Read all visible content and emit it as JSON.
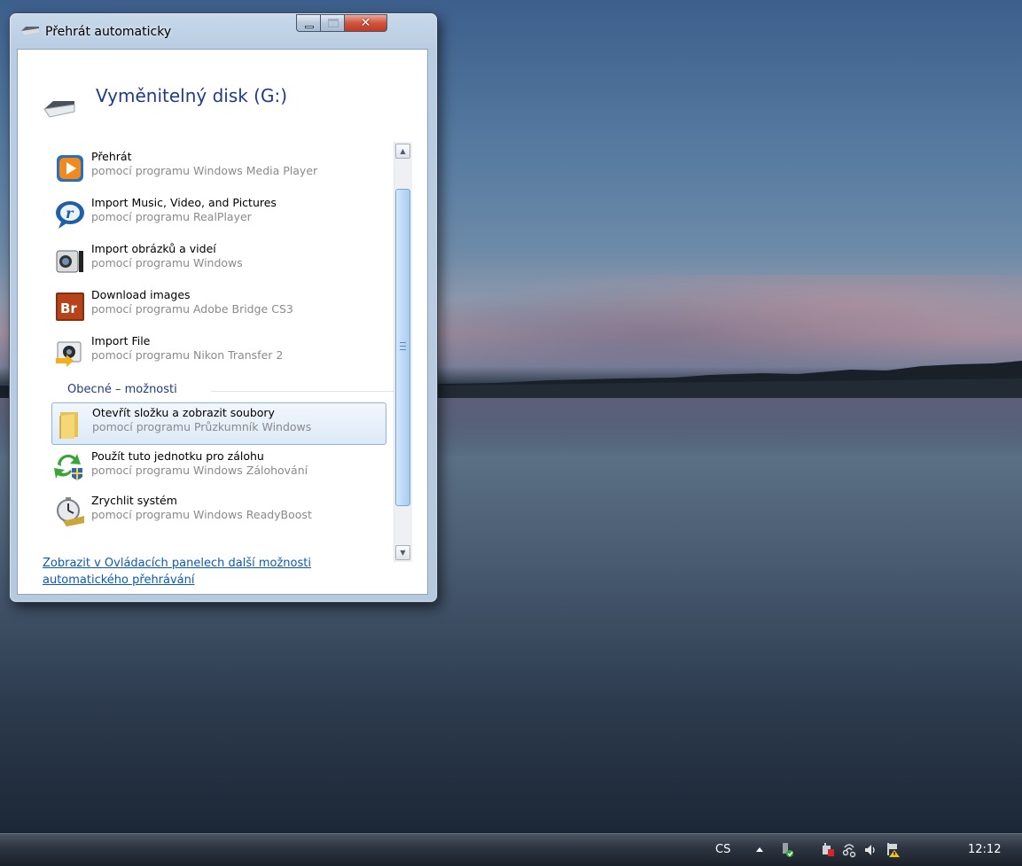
{
  "window": {
    "title": "Přehrát automaticky",
    "device_title": "Vyměnitelný disk (G:)"
  },
  "programs": [
    {
      "action": "Přehrát",
      "source": "pomocí programu Windows Media Player",
      "icon": "windows-media-player-icon"
    },
    {
      "action": "Import Music, Video, and Pictures",
      "source": "pomocí programu RealPlayer",
      "icon": "realplayer-icon"
    },
    {
      "action": "Import obrázků a videí",
      "source": "pomocí programu Windows",
      "icon": "camera-icon"
    },
    {
      "action": "Download images",
      "source": "pomocí programu Adobe Bridge CS3",
      "icon": "adobe-bridge-icon"
    },
    {
      "action": "Import File",
      "source": "pomocí programu Nikon Transfer 2",
      "icon": "nikon-transfer-icon"
    }
  ],
  "general": {
    "header": "Obecné – možnosti",
    "items": [
      {
        "action": "Otevřít složku a zobrazit soubory",
        "source": "pomocí programu Průzkumník Windows",
        "icon": "folder-icon",
        "selected": true
      },
      {
        "action": "Použít tuto jednotku pro zálohu",
        "source": "pomocí programu Windows Zálohování",
        "icon": "backup-icon"
      },
      {
        "action": "Zrychlit systém",
        "source": "pomocí programu Windows ReadyBoost",
        "icon": "readyboost-stopwatch-icon"
      }
    ]
  },
  "footer_link": "Zobrazit v Ovládacích panelech další možnosti automatického přehrávání",
  "taskbar": {
    "language": "CS",
    "clock": "12:12",
    "tray_icons": [
      "show-hidden-icons-arrow",
      "safely-remove-hardware-icon",
      "power-plug-icon",
      "network-icon",
      "volume-icon",
      "action-center-warning-icon"
    ]
  },
  "colors": {
    "heading_blue": "#1e3c8a",
    "link_blue": "#0a59b8",
    "selection_border": "#8eb4e3",
    "close_button_red": "#d0543c"
  }
}
